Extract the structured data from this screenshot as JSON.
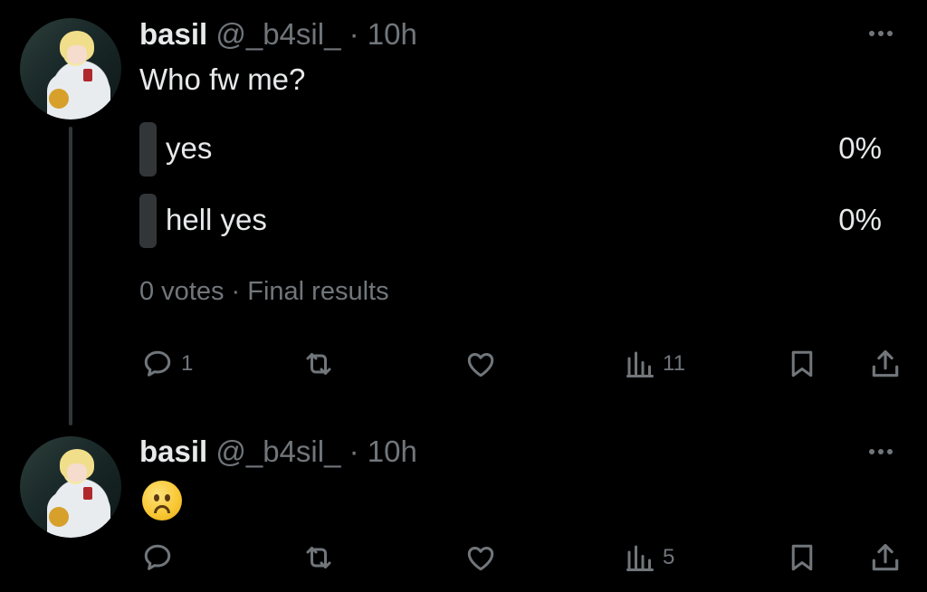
{
  "tweets": [
    {
      "display_name": "basil",
      "handle": "@_b4sil_",
      "time": "· 10h",
      "text": "Who fw me?",
      "poll": {
        "options": [
          {
            "label": "yes",
            "percent": "0%"
          },
          {
            "label": "hell yes",
            "percent": "0%"
          }
        ],
        "summary": "0 votes · Final results"
      },
      "actions": {
        "replies": "1",
        "views": "11"
      }
    },
    {
      "display_name": "basil",
      "handle": "@_b4sil_",
      "time": "· 10h",
      "emoji": "frowning-face",
      "actions": {
        "views": "5"
      }
    }
  ],
  "icons": [
    "reply-icon",
    "retweet-icon",
    "like-icon",
    "views-icon",
    "bookmark-icon",
    "share-icon",
    "more-icon"
  ],
  "colors": {
    "background": "#000000",
    "text": "#e7e9ea",
    "secondary": "#71767b",
    "poll_bar": "#333639"
  }
}
